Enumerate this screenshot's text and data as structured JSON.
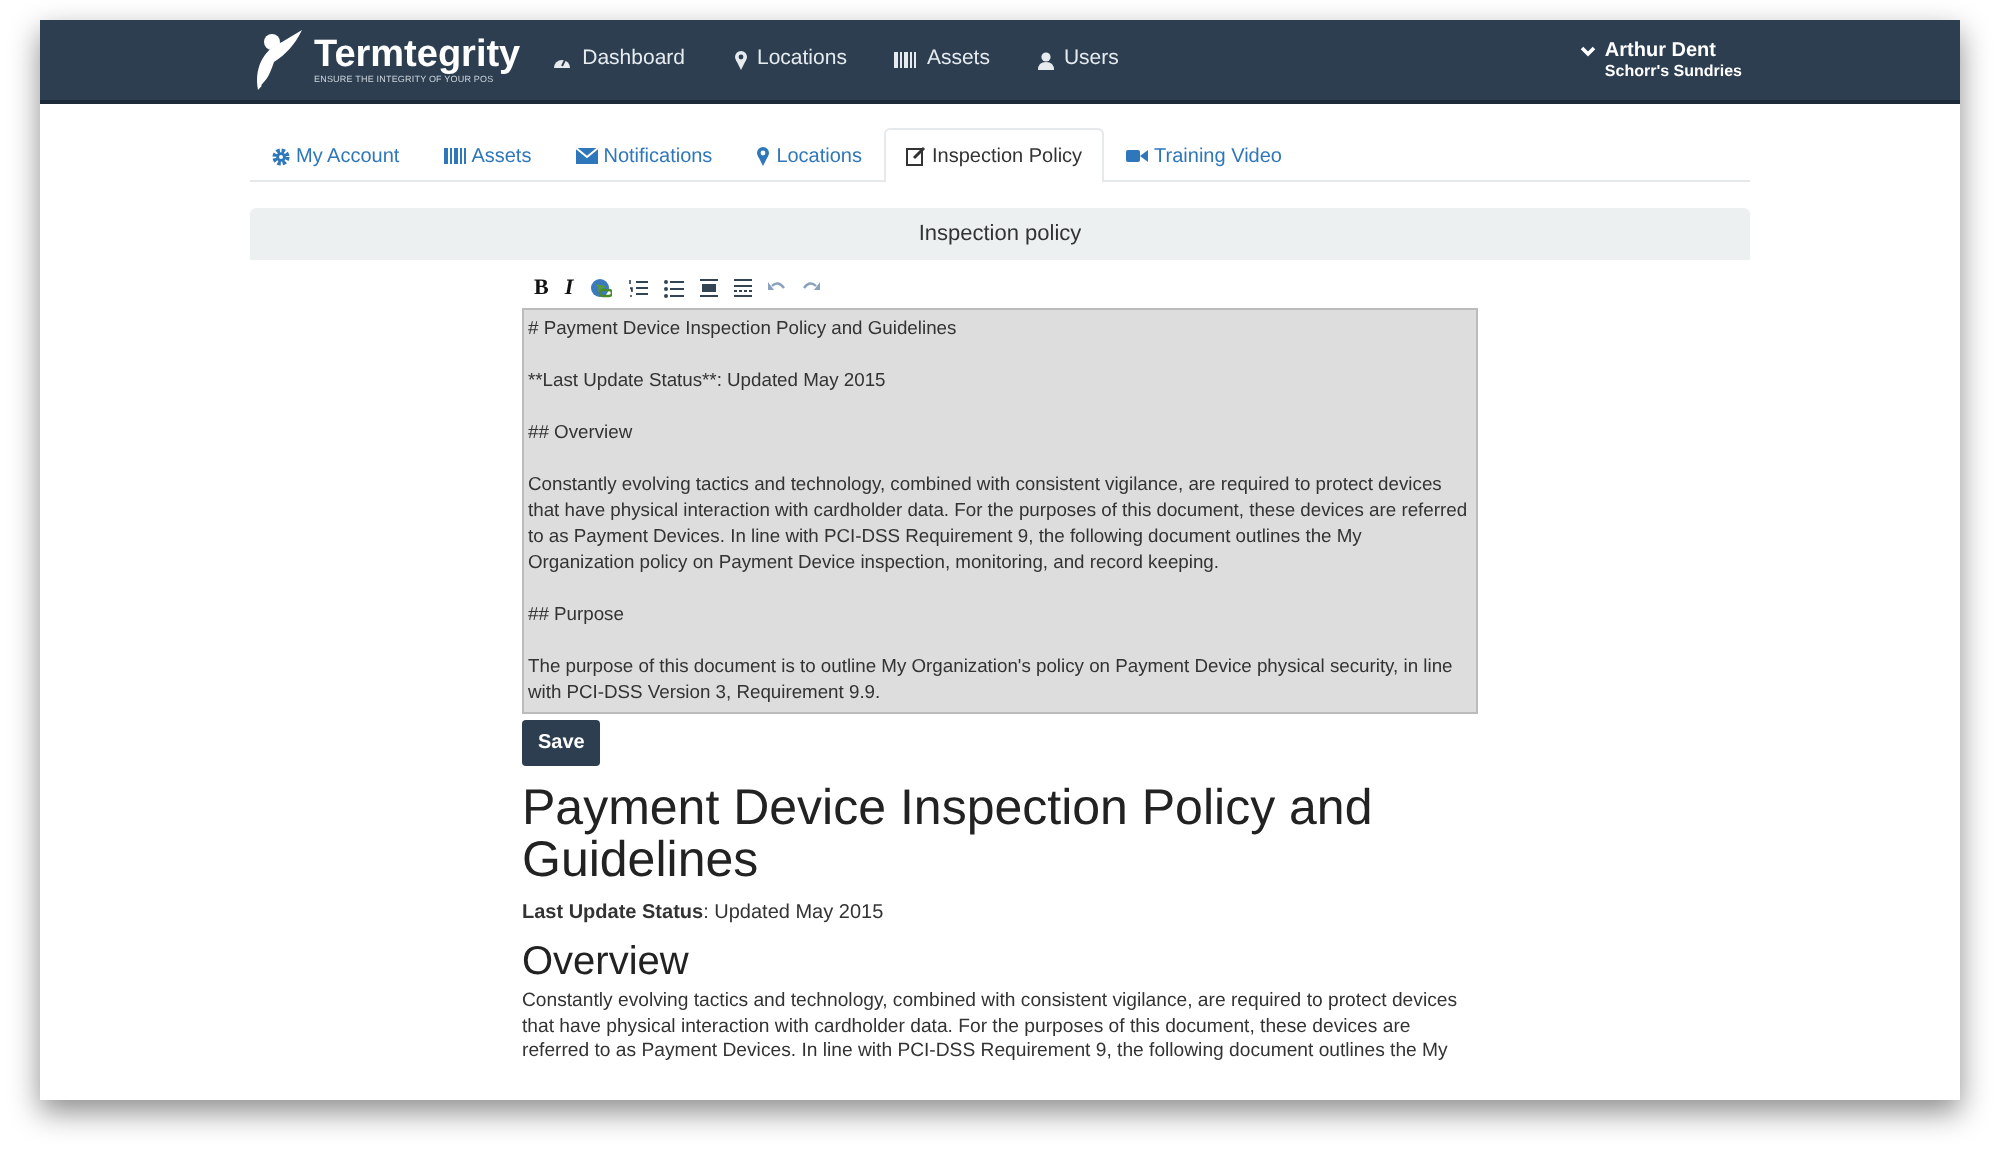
{
  "navbar": {
    "brand": "Termtegrity",
    "tagline": "ENSURE THE INTEGRITY OF YOUR POS",
    "items": [
      {
        "label": "Dashboard"
      },
      {
        "label": "Locations"
      },
      {
        "label": "Assets"
      },
      {
        "label": "Users"
      }
    ],
    "user": {
      "name": "Arthur Dent",
      "organization": "Schorr's Sundries"
    }
  },
  "tabs": [
    {
      "label": "My Account",
      "selected": false
    },
    {
      "label": "Assets",
      "selected": false
    },
    {
      "label": "Notifications",
      "selected": false
    },
    {
      "label": "Locations",
      "selected": false
    },
    {
      "label": "Inspection Policy",
      "selected": true
    },
    {
      "label": "Training Video",
      "selected": false
    }
  ],
  "panel": {
    "title": "Inspection policy",
    "toolbar": [
      {
        "kind": "bold",
        "label": "B"
      },
      {
        "kind": "italic",
        "label": "I"
      },
      {
        "kind": "link"
      },
      {
        "kind": "ordered-list"
      },
      {
        "kind": "bullet-list"
      },
      {
        "kind": "heading"
      },
      {
        "kind": "rule"
      },
      {
        "kind": "undo"
      },
      {
        "kind": "redo"
      }
    ],
    "editor_value": "# Payment Device Inspection Policy and Guidelines\n\n**Last Update Status**: Updated May 2015\n\n## Overview\n\nConstantly evolving tactics and technology, combined with consistent vigilance, are required to protect devices that have physical interaction with cardholder data. For the purposes of this document, these devices are referred to as Payment Devices. In line with PCI-DSS Requirement 9, the following document outlines the My Organization policy on Payment Device inspection, monitoring, and record keeping.\n\n## Purpose\n\nThe purpose of this document is to outline My Organization's policy on Payment Device physical security, in line with PCI-DSS Version 3, Requirement 9.9.",
    "save_button": "Save"
  },
  "document": {
    "title": "Payment Device Inspection Policy and Guidelines",
    "status": "**Last Update Status**: Updated May 2015",
    "sections": [
      {
        "heading": "Overview",
        "paragraph": "Constantly evolving tactics and technology, combined with consistent vigilance, are required to protect devices that have physical interaction with cardholder data. For the purposes of this document, these devices are referred to as Payment Devices. In line with PCI-DSS Requirement 9, the following document outlines the My"
      }
    ]
  }
}
